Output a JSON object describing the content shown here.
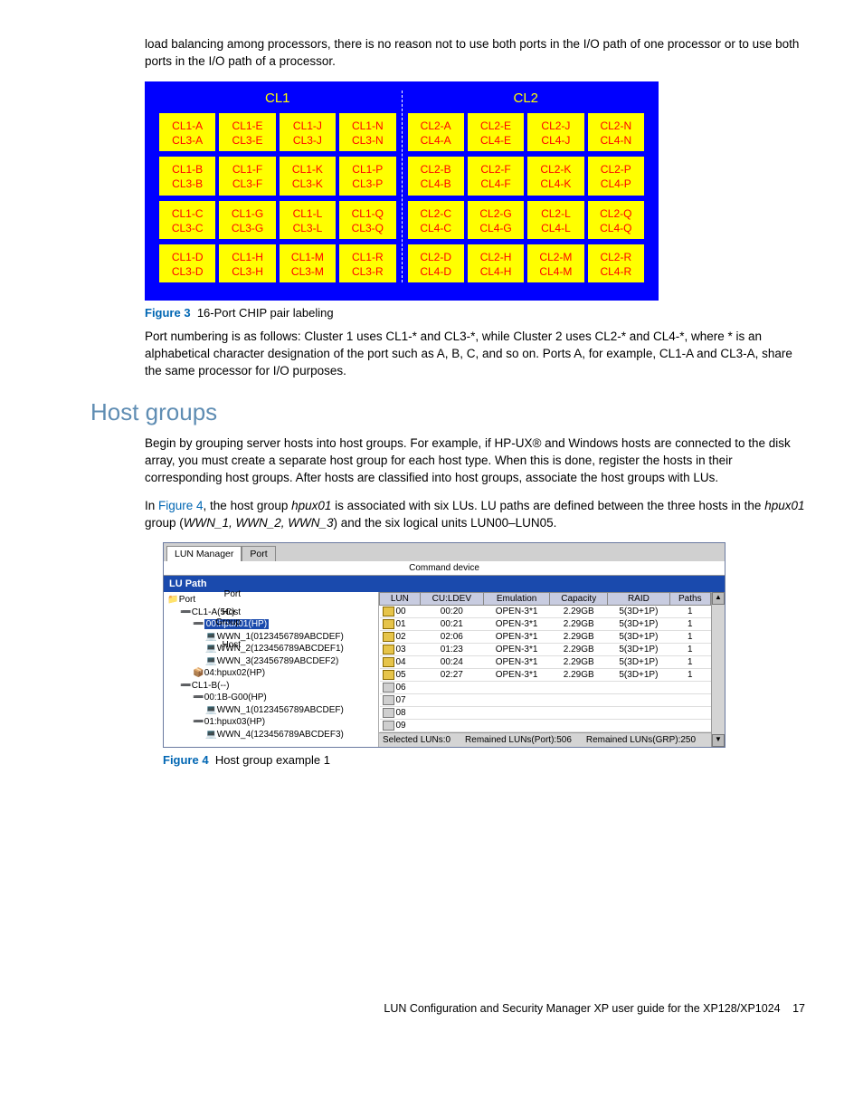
{
  "intro_paragraph": "load balancing among processors, there is no reason not to use both ports in the I/O path of one processor or to use both ports in the I/O path of a processor.",
  "chart_data": {
    "type": "table",
    "title": "16-Port CHIP pair labeling",
    "clusters": [
      {
        "name": "CL1",
        "cells": [
          [
            "CL1-A",
            "CL3-A"
          ],
          [
            "CL1-E",
            "CL3-E"
          ],
          [
            "CL1-J",
            "CL3-J"
          ],
          [
            "CL1-N",
            "CL3-N"
          ],
          [
            "CL1-B",
            "CL3-B"
          ],
          [
            "CL1-F",
            "CL3-F"
          ],
          [
            "CL1-K",
            "CL3-K"
          ],
          [
            "CL1-P",
            "CL3-P"
          ],
          [
            "CL1-C",
            "CL3-C"
          ],
          [
            "CL1-G",
            "CL3-G"
          ],
          [
            "CL1-L",
            "CL3-L"
          ],
          [
            "CL1-Q",
            "CL3-Q"
          ],
          [
            "CL1-D",
            "CL3-D"
          ],
          [
            "CL1-H",
            "CL3-H"
          ],
          [
            "CL1-M",
            "CL3-M"
          ],
          [
            "CL1-R",
            "CL3-R"
          ]
        ]
      },
      {
        "name": "CL2",
        "cells": [
          [
            "CL2-A",
            "CL4-A"
          ],
          [
            "CL2-E",
            "CL4-E"
          ],
          [
            "CL2-J",
            "CL4-J"
          ],
          [
            "CL2-N",
            "CL4-N"
          ],
          [
            "CL2-B",
            "CL4-B"
          ],
          [
            "CL2-F",
            "CL4-F"
          ],
          [
            "CL2-K",
            "CL4-K"
          ],
          [
            "CL2-P",
            "CL4-P"
          ],
          [
            "CL2-C",
            "CL4-C"
          ],
          [
            "CL2-G",
            "CL4-G"
          ],
          [
            "CL2-L",
            "CL4-L"
          ],
          [
            "CL2-Q",
            "CL4-Q"
          ],
          [
            "CL2-D",
            "CL4-D"
          ],
          [
            "CL2-H",
            "CL4-H"
          ],
          [
            "CL2-M",
            "CL4-M"
          ],
          [
            "CL2-R",
            "CL4-R"
          ]
        ]
      }
    ]
  },
  "figure3": {
    "label": "Figure 3",
    "caption": "16-Port CHIP pair labeling"
  },
  "port_numbering_para": "Port numbering is as follows: Cluster 1 uses CL1-* and CL3-*, while Cluster 2 uses CL2-* and CL4-*, where * is an alphabetical character designation of the port such as A, B, C, and so on. Ports A, for example, CL1-A and CL3-A, share the same processor for I/O purposes.",
  "section_heading": "Host groups",
  "hostgroups_para1": "Begin by grouping server hosts into host groups. For example, if HP-UX® and Windows hosts are connected to the disk array, you must create a separate host group for each host type. When this is done, register the hosts in their corresponding host groups. After hosts are classified into host groups, associate the host groups with LUs.",
  "hostgroups_para2_prefix": "In ",
  "hostgroups_para2_link": "Figure 4",
  "hostgroups_para2_mid": ", the host group ",
  "hostgroups_para2_hpux": "hpux01",
  "hostgroups_para2_mid2": " is associated with six LUs. LU paths are defined between the three hosts in the ",
  "hostgroups_para2_hpux2": "hpux01",
  "hostgroups_para2_mid3": " group (",
  "hostgroups_para2_wwn": "WWN_1, WWN_2, WWN_3",
  "hostgroups_para2_end": ") and the six logical units LUN00–LUN05.",
  "app": {
    "tabs": {
      "lun_manager": "LUN Manager",
      "port": "Port"
    },
    "command_device": "Command device",
    "lu_path": "LU Path",
    "tree": {
      "root": "Port",
      "items": [
        {
          "indent": 0,
          "icon": "📁",
          "text": "Port"
        },
        {
          "indent": 1,
          "icon": "➖",
          "text": "CL1-A(5C)"
        },
        {
          "indent": 2,
          "icon": "➖",
          "text": "00:hpux01(HP)",
          "highlight": true
        },
        {
          "indent": 3,
          "icon": "💻",
          "text": "WWN_1(0123456789ABCDEF)"
        },
        {
          "indent": 3,
          "icon": "💻",
          "text": "WWN_2(123456789ABCDEF1)"
        },
        {
          "indent": 3,
          "icon": "💻",
          "text": "WWN_3(23456789ABCDEF2)"
        },
        {
          "indent": 2,
          "icon": "📦",
          "text": "04:hpux02(HP)"
        },
        {
          "indent": 1,
          "icon": "➖",
          "text": "CL1-B(--)"
        },
        {
          "indent": 2,
          "icon": "➖",
          "text": "00:1B-G00(HP)"
        },
        {
          "indent": 3,
          "icon": "💻",
          "text": "WWN_1(0123456789ABCDEF)"
        },
        {
          "indent": 2,
          "icon": "➖",
          "text": "01:hpux03(HP)"
        },
        {
          "indent": 3,
          "icon": "💻",
          "text": "WWN_4(123456789ABCDEF3)"
        }
      ]
    },
    "table": {
      "columns": [
        "LUN",
        "CU:LDEV",
        "Emulation",
        "Capacity",
        "RAID",
        "Paths"
      ],
      "rows": [
        {
          "lun": "00",
          "culdev": "00:20",
          "emu": "OPEN-3*1",
          "cap": "2.29GB",
          "raid": "5(3D+1P)",
          "paths": "1",
          "icon": "y"
        },
        {
          "lun": "01",
          "culdev": "00:21",
          "emu": "OPEN-3*1",
          "cap": "2.29GB",
          "raid": "5(3D+1P)",
          "paths": "1",
          "icon": "y"
        },
        {
          "lun": "02",
          "culdev": "02:06",
          "emu": "OPEN-3*1",
          "cap": "2.29GB",
          "raid": "5(3D+1P)",
          "paths": "1",
          "icon": "y"
        },
        {
          "lun": "03",
          "culdev": "01:23",
          "emu": "OPEN-3*1",
          "cap": "2.29GB",
          "raid": "5(3D+1P)",
          "paths": "1",
          "icon": "y"
        },
        {
          "lun": "04",
          "culdev": "00:24",
          "emu": "OPEN-3*1",
          "cap": "2.29GB",
          "raid": "5(3D+1P)",
          "paths": "1",
          "icon": "y"
        },
        {
          "lun": "05",
          "culdev": "02:27",
          "emu": "OPEN-3*1",
          "cap": "2.29GB",
          "raid": "5(3D+1P)",
          "paths": "1",
          "icon": "y"
        },
        {
          "lun": "06",
          "culdev": "",
          "emu": "",
          "cap": "",
          "raid": "",
          "paths": "",
          "icon": "g"
        },
        {
          "lun": "07",
          "culdev": "",
          "emu": "",
          "cap": "",
          "raid": "",
          "paths": "",
          "icon": "g"
        },
        {
          "lun": "08",
          "culdev": "",
          "emu": "",
          "cap": "",
          "raid": "",
          "paths": "",
          "icon": "g"
        },
        {
          "lun": "09",
          "culdev": "",
          "emu": "",
          "cap": "",
          "raid": "",
          "paths": "",
          "icon": "g"
        }
      ]
    },
    "status": {
      "selected": "Selected LUNs:0",
      "remained_port": "Remained LUNs(Port):506",
      "remained_grp": "Remained LUNs(GRP):250"
    },
    "annotations": {
      "port": "Port",
      "hostgroup": "Host\nGroup",
      "host": "Host"
    }
  },
  "figure4": {
    "label": "Figure 4",
    "caption": "Host group example 1"
  },
  "footer": {
    "text": "LUN Configuration and Security Manager XP user guide for the XP128/XP1024",
    "page": "17"
  }
}
